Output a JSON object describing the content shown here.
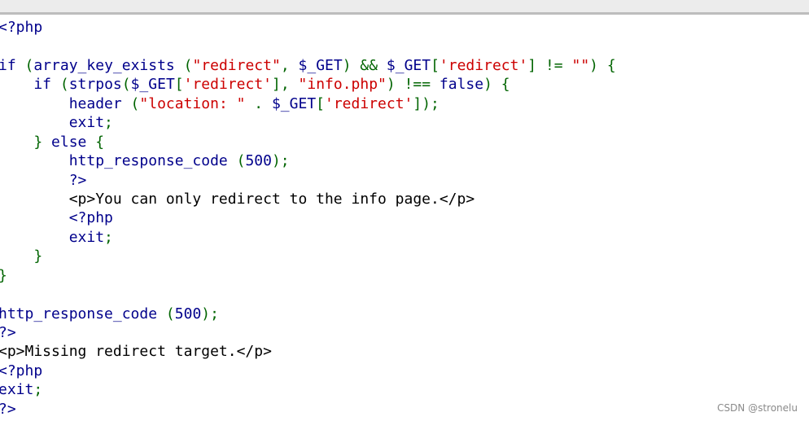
{
  "editor": {
    "lines": [
      [
        {
          "t": "<?php",
          "c": "fn"
        }
      ],
      [],
      [
        {
          "t": "if",
          "c": "kw"
        },
        {
          "t": " (",
          "c": "op"
        },
        {
          "t": "array_key_exists",
          "c": "fn"
        },
        {
          "t": " (",
          "c": "op"
        },
        {
          "t": "\"redirect\"",
          "c": "str"
        },
        {
          "t": ", ",
          "c": "op"
        },
        {
          "t": "$_GET",
          "c": "var"
        },
        {
          "t": ") && ",
          "c": "op"
        },
        {
          "t": "$_GET",
          "c": "var"
        },
        {
          "t": "[",
          "c": "op"
        },
        {
          "t": "'redirect'",
          "c": "str"
        },
        {
          "t": "] != ",
          "c": "op"
        },
        {
          "t": "\"\"",
          "c": "str"
        },
        {
          "t": ") {",
          "c": "op"
        }
      ],
      [
        {
          "t": "    if",
          "c": "kw"
        },
        {
          "t": " (",
          "c": "op"
        },
        {
          "t": "strpos",
          "c": "fn"
        },
        {
          "t": "(",
          "c": "op"
        },
        {
          "t": "$_GET",
          "c": "var"
        },
        {
          "t": "[",
          "c": "op"
        },
        {
          "t": "'redirect'",
          "c": "str"
        },
        {
          "t": "], ",
          "c": "op"
        },
        {
          "t": "\"info.php\"",
          "c": "str"
        },
        {
          "t": ") !== ",
          "c": "op"
        },
        {
          "t": "false",
          "c": "kw"
        },
        {
          "t": ") {",
          "c": "op"
        }
      ],
      [
        {
          "t": "        header",
          "c": "fn"
        },
        {
          "t": " (",
          "c": "op"
        },
        {
          "t": "\"location: \"",
          "c": "str"
        },
        {
          "t": " . ",
          "c": "op"
        },
        {
          "t": "$_GET",
          "c": "var"
        },
        {
          "t": "[",
          "c": "op"
        },
        {
          "t": "'redirect'",
          "c": "str"
        },
        {
          "t": "]);",
          "c": "op"
        }
      ],
      [
        {
          "t": "        exit",
          "c": "kw"
        },
        {
          "t": ";",
          "c": "op"
        }
      ],
      [
        {
          "t": "    }",
          "c": "op"
        },
        {
          "t": " else ",
          "c": "kw"
        },
        {
          "t": "{",
          "c": "op"
        }
      ],
      [
        {
          "t": "        http_response_code",
          "c": "fn"
        },
        {
          "t": " (",
          "c": "op"
        },
        {
          "t": "500",
          "c": "num"
        },
        {
          "t": ");",
          "c": "op"
        }
      ],
      [
        {
          "t": "        ?>",
          "c": "fn"
        }
      ],
      [
        {
          "t": "        <p>You can only redirect to the info page.</p>",
          "c": "plain"
        }
      ],
      [
        {
          "t": "        <?php",
          "c": "fn"
        }
      ],
      [
        {
          "t": "        exit",
          "c": "kw"
        },
        {
          "t": ";",
          "c": "op"
        }
      ],
      [
        {
          "t": "    }",
          "c": "op"
        }
      ],
      [
        {
          "t": "}",
          "c": "op"
        }
      ],
      [],
      [
        {
          "t": "http_response_code",
          "c": "fn"
        },
        {
          "t": " (",
          "c": "op"
        },
        {
          "t": "500",
          "c": "num"
        },
        {
          "t": ");",
          "c": "op"
        }
      ],
      [
        {
          "t": "?>",
          "c": "fn"
        }
      ],
      [
        {
          "t": "<p>Missing redirect target.</p>",
          "c": "plain"
        }
      ],
      [
        {
          "t": "<?php",
          "c": "fn"
        }
      ],
      [
        {
          "t": "exit",
          "c": "kw"
        },
        {
          "t": ";",
          "c": "op"
        }
      ],
      [
        {
          "t": "?>",
          "c": "fn"
        }
      ]
    ]
  },
  "watermark": "CSDN @stronelu",
  "colors": {
    "keyword": "#00008b",
    "string": "#cc0000",
    "operator": "#006400",
    "plain": "#000000",
    "background": "#ffffff"
  }
}
